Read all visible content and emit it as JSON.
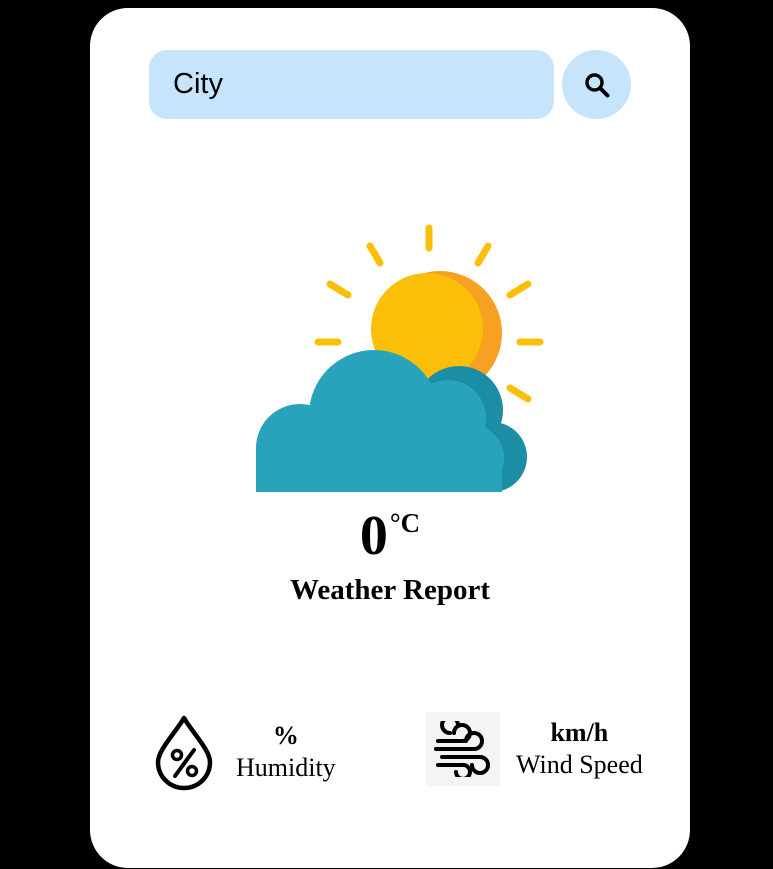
{
  "search": {
    "placeholder": "City"
  },
  "weather": {
    "icon": "sun-behind-cloud-icon",
    "temperature": "0",
    "unit": "°C",
    "condition": "Weather Report"
  },
  "humidity": {
    "value": "%",
    "label": "Humidity",
    "icon": "humidity-drop-icon"
  },
  "wind": {
    "value": "km/h",
    "label": "Wind Speed",
    "icon": "wind-icon"
  },
  "colors": {
    "background": "#000000",
    "card": "#ffffff",
    "search_bg": "#c6e4fb",
    "sun": "#fbbf09",
    "sun_shade": "#f7a021",
    "cloud": "#28a3bb",
    "cloud_shade": "#1b8ea6"
  }
}
